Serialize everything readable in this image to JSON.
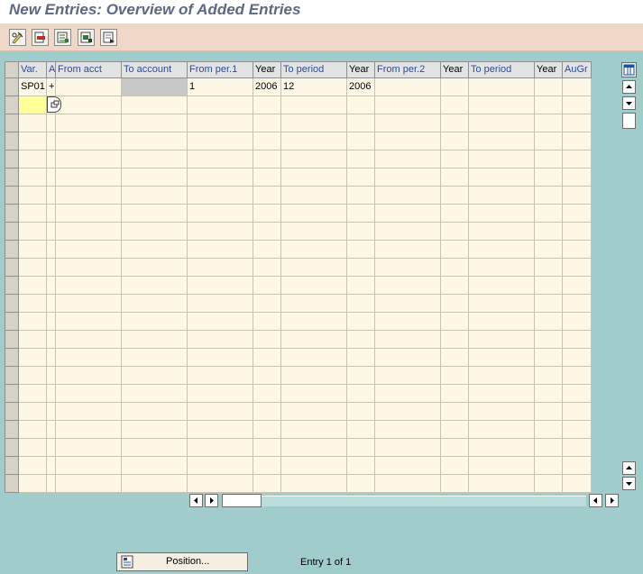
{
  "title": "New Entries: Overview of Added Entries",
  "toolbar": {
    "buttons": [
      {
        "name": "change-display-icon"
      },
      {
        "name": "delete-icon"
      },
      {
        "name": "select-all-icon"
      },
      {
        "name": "select-block-icon"
      },
      {
        "name": "deselect-all-icon"
      }
    ]
  },
  "table": {
    "columns": [
      {
        "label": "Var."
      },
      {
        "label": "A"
      },
      {
        "label": "From acct"
      },
      {
        "label": "To account"
      },
      {
        "label": "From per.1"
      },
      {
        "label": "Year"
      },
      {
        "label": "To period"
      },
      {
        "label": "Year"
      },
      {
        "label": "From per.2"
      },
      {
        "label": "Year"
      },
      {
        "label": "To period"
      },
      {
        "label": "Year"
      },
      {
        "label": "AuGr"
      }
    ],
    "rows": [
      [
        "SP01",
        "+",
        "",
        "",
        "1",
        "2006",
        "12",
        "2006",
        "",
        "",
        "",
        "",
        ""
      ]
    ],
    "empty_row_count": 22
  },
  "footer": {
    "position_button_label": "Position...",
    "entry_status": "Entry 1 of 1"
  }
}
